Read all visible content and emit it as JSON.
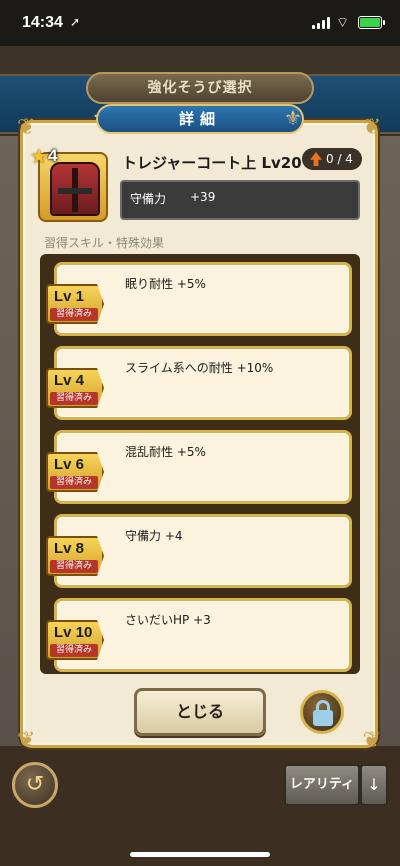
{
  "status_bar": {
    "time": "14:34",
    "location_glyph": "➚",
    "wifi_glyph": "⌔"
  },
  "background": {
    "screen_title": "強化そうび選択"
  },
  "modal": {
    "title": "詳細",
    "item": {
      "name": "トレジャーコート上 Lv20",
      "stars": "4",
      "upgrade": "0 / 4",
      "stat_label": "守備力",
      "stat_value": "+39"
    },
    "section_label": "習得スキル・特殊効果",
    "skills": [
      {
        "level": "Lv 1",
        "status": "習得済み",
        "text": "眠り耐性 +5%"
      },
      {
        "level": "Lv 4",
        "status": "習得済み",
        "text": "スライム系への耐性 +10%"
      },
      {
        "level": "Lv 6",
        "status": "習得済み",
        "text": "混乱耐性 +5%"
      },
      {
        "level": "Lv 8",
        "status": "習得済み",
        "text": "守備力 +4"
      },
      {
        "level": "Lv 10",
        "status": "習得済み",
        "text": "さいだいHP +3"
      }
    ],
    "close_label": "とじる"
  },
  "footer": {
    "rarity_label": "レアリティ",
    "back_glyph": "↺",
    "rarity_arrow_glyph": "↓"
  },
  "colors": {
    "accent_gold": "#c9a24a",
    "header_blue": "#2d77b3",
    "level_tag_gold": "#f6d45a",
    "acquired_red": "#b6372a"
  }
}
